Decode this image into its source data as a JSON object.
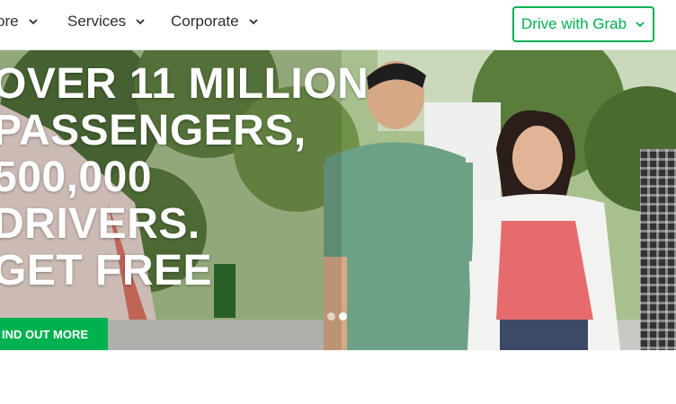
{
  "nav": {
    "items": [
      {
        "label": "ore"
      },
      {
        "label": "Services"
      },
      {
        "label": "Corporate"
      }
    ],
    "drive_button": {
      "label": "Drive with Grab"
    }
  },
  "hero": {
    "headline_lines": [
      "OVER 11 MILLION",
      "PASSENGERS,",
      "500,000",
      "DRIVERS.",
      "GET FREE"
    ],
    "cta_label": "IND OUT MORE",
    "carousel": {
      "total": 2,
      "active_index": 1
    }
  },
  "colors": {
    "brand_green": "#00b14f",
    "nav_text": "#2e2e2e",
    "headline_text": "#ffffff"
  },
  "icons": {
    "nav_chevron": "chevron-down-icon",
    "button_chevron": "chevron-down-icon"
  }
}
